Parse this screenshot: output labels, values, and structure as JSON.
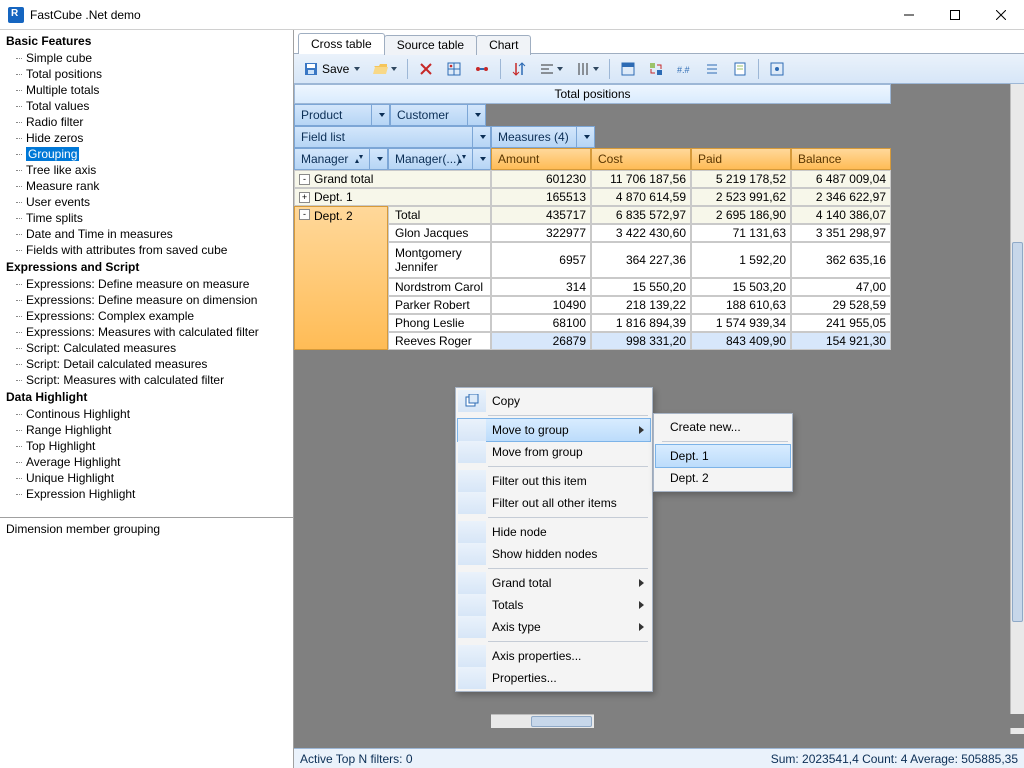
{
  "window": {
    "title": "FastCube .Net demo"
  },
  "tree": {
    "groups": [
      {
        "title": "Basic Features",
        "items": [
          "Simple cube",
          "Total positions",
          "Multiple totals",
          "Total values",
          "Radio filter",
          "Hide zeros",
          "Grouping",
          "Tree like axis",
          "Measure rank",
          "User events",
          "Time splits",
          "Date and Time in measures",
          "Fields with attributes from saved cube"
        ],
        "selected_index": 6
      },
      {
        "title": "Expressions and Script",
        "items": [
          "Expressions: Define measure on measure",
          "Expressions: Define measure on dimension",
          "Expressions: Complex example",
          "Expressions: Measures with calculated filter",
          "Script: Calculated measures",
          "Script: Detail calculated measures",
          "Script: Measures with calculated filter"
        ]
      },
      {
        "title": "Data Highlight",
        "items": [
          "Continous Highlight",
          "Range Highlight",
          "Top Highlight",
          "Average Highlight",
          "Unique Highlight",
          "Expression Highlight"
        ]
      }
    ],
    "description": "Dimension member grouping"
  },
  "tabs": {
    "items": [
      "Cross table",
      "Source table",
      "Chart"
    ],
    "active": 0
  },
  "toolbar": {
    "save": "Save"
  },
  "pivot": {
    "title": "Total positions",
    "col_dims": [
      "Product",
      "Customer"
    ],
    "left_top": "Field list",
    "measures_btn": "Measures (4)",
    "row_dims": [
      "Manager",
      "Manager(...)"
    ],
    "measures": [
      "Amount",
      "Cost",
      "Paid",
      "Balance"
    ],
    "rows": [
      {
        "kind": "grand",
        "label": "Grand total",
        "exp": "-",
        "vals": [
          "601230",
          "11 706 187,56",
          "5 219 178,52",
          "6 487 009,04"
        ]
      },
      {
        "kind": "dept",
        "label": "Dept. 1",
        "exp": "+",
        "vals": [
          "165513",
          "4 870 614,59",
          "2 523 991,62",
          "2 346 622,97"
        ]
      },
      {
        "kind": "dept2",
        "label": "Dept. 2",
        "exp": "-",
        "children": [
          {
            "label": "Total",
            "vals": [
              "435717",
              "6 835 572,97",
              "2 695 186,90",
              "4 140 386,07"
            ]
          },
          {
            "label": "Glon Jacques",
            "vals": [
              "322977",
              "3 422 430,60",
              "71 131,63",
              "3 351 298,97"
            ]
          },
          {
            "label": "Montgomery Jennifer",
            "vals": [
              "6957",
              "364 227,36",
              "1 592,20",
              "362 635,16"
            ],
            "tall": true
          },
          {
            "label": "Nordstrom Carol",
            "vals": [
              "314",
              "15 550,20",
              "15 503,20",
              "47,00"
            ]
          },
          {
            "label": "Parker Robert",
            "vals": [
              "10490",
              "218 139,22",
              "188 610,63",
              "29 528,59"
            ]
          },
          {
            "label": "Phong  Leslie",
            "vals": [
              "68100",
              "1 816 894,39",
              "1 574 939,34",
              "241 955,05"
            ]
          },
          {
            "label": "Reeves  Roger",
            "vals": [
              "26879",
              "998 331,20",
              "843 409,90",
              "154 921,30"
            ],
            "selected": true
          }
        ]
      }
    ]
  },
  "ctx": {
    "main": [
      "Copy",
      "Move to group",
      "Move from group",
      "Filter out this item",
      "Filter out all other items",
      "Hide node",
      "Show hidden nodes",
      "Grand total",
      "Totals",
      "Axis type",
      "Axis properties...",
      "Properties..."
    ],
    "main_hl": 1,
    "main_submenu_idx": [
      1,
      7,
      8,
      9
    ],
    "sub": [
      "Create new...",
      "Dept. 1",
      "Dept. 2"
    ],
    "sub_hl": 1
  },
  "status": {
    "left": "Active Top N filters: 0",
    "right": "Sum: 2023541,4 Count: 4 Average: 505885,35"
  }
}
